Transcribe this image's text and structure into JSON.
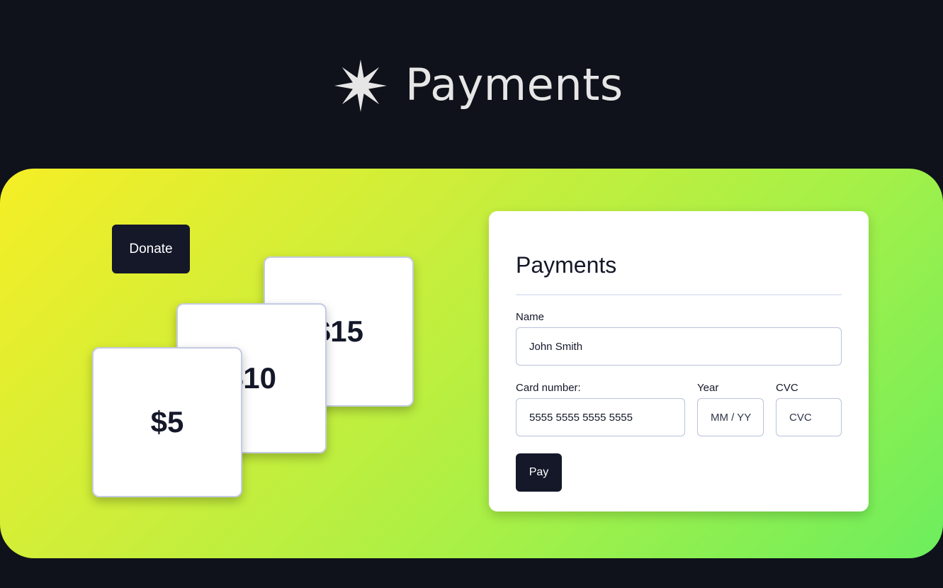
{
  "header": {
    "title": "Payments",
    "logo_icon": "star-icon",
    "logo_color": "#e6e6e6"
  },
  "colors": {
    "background": "#0f121a",
    "gradient_start": "#f5ee26",
    "gradient_end": "#6cee5e",
    "button": "#141829"
  },
  "donation": {
    "button_label": "Donate",
    "cards": [
      {
        "label": "$15"
      },
      {
        "label": "$10"
      },
      {
        "label": "$5"
      }
    ]
  },
  "payment_form": {
    "title": "Payments",
    "name_label": "Name",
    "name_value": "John Smith",
    "card_label": "Card number:",
    "card_value": "5555 5555 5555 5555",
    "year_label": "Year",
    "year_placeholder": "MM / YY",
    "cvc_label": "CVC",
    "cvc_placeholder": "CVC",
    "pay_label": "Pay"
  }
}
